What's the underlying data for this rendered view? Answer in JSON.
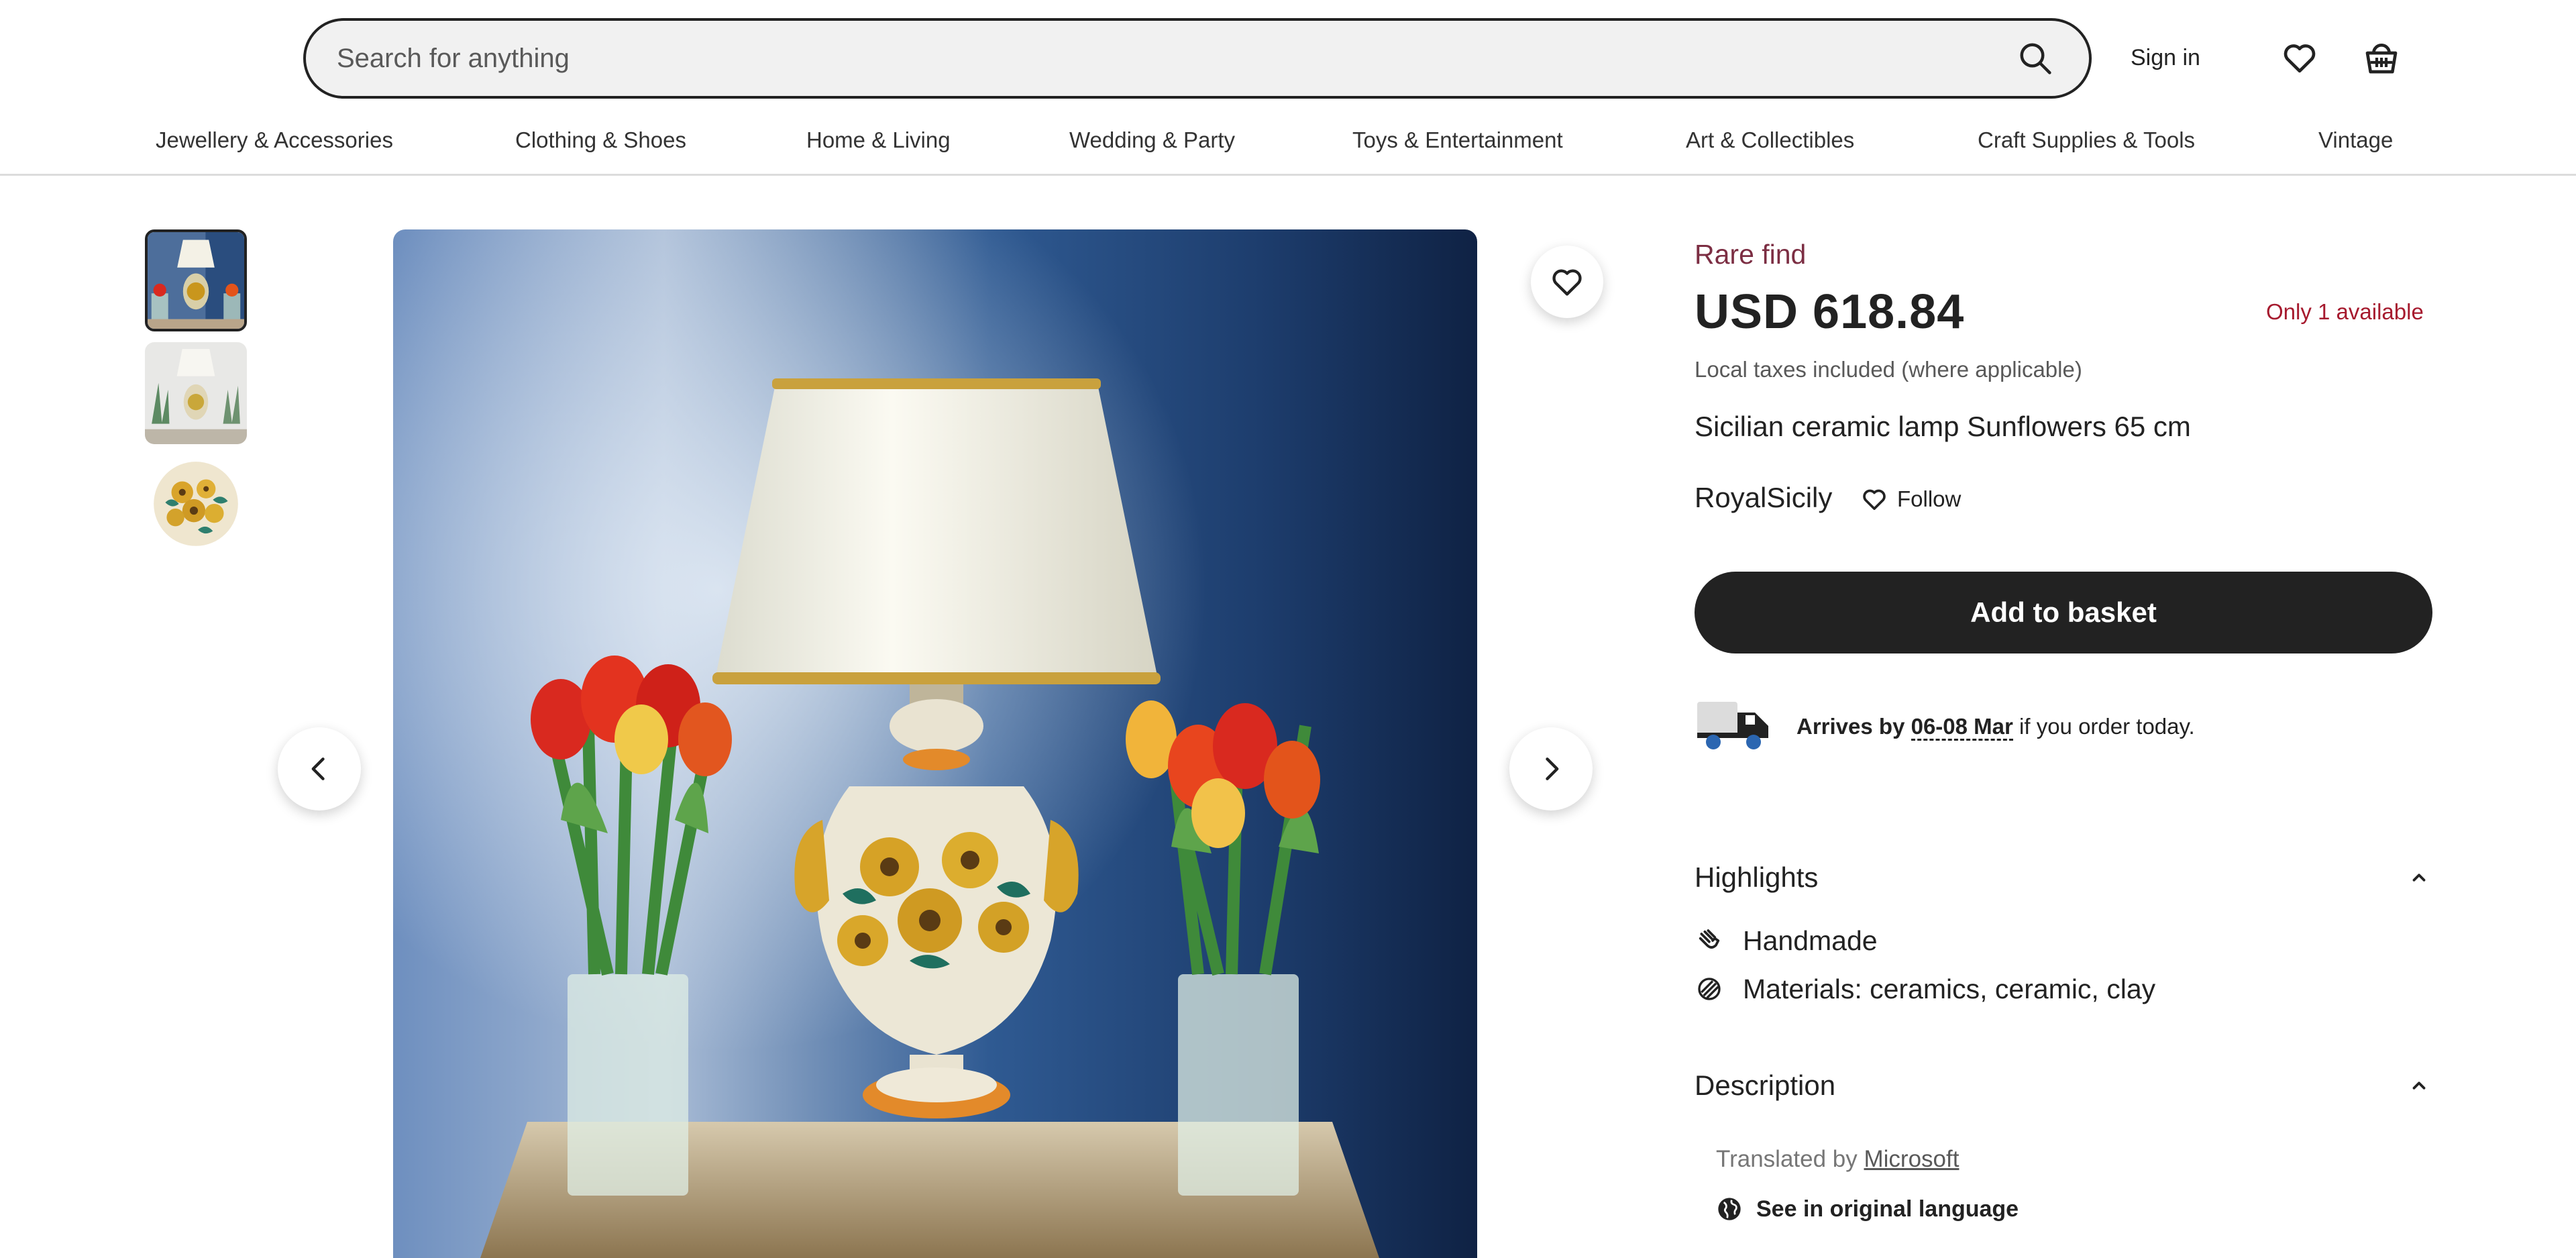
{
  "header": {
    "search_placeholder": "Search for anything",
    "sign_in": "Sign in",
    "icons": [
      "search-icon",
      "heart-icon",
      "basket-icon"
    ]
  },
  "categories": [
    "Jewellery & Accessories",
    "Clothing & Shoes",
    "Home & Living",
    "Wedding & Party",
    "Toys & Entertainment",
    "Art & Collectibles",
    "Craft Supplies & Tools",
    "Vintage"
  ],
  "listing": {
    "rare_find": "Rare find",
    "price": "USD 618.84",
    "availability": "Only 1 available",
    "tax_note": "Local taxes included (where applicable)",
    "title": "Sicilian ceramic lamp Sunflowers 65 cm",
    "shop_name": "RoyalSicily",
    "follow_label": "Follow",
    "add_to_basket": "Add to basket",
    "delivery": {
      "prefix": "Arrives by ",
      "date": "06-08 Mar",
      "suffix": " if you order today."
    },
    "highlights": {
      "title": "Highlights",
      "items": [
        "Handmade",
        "Materials: ceramics, ceramic, clay"
      ]
    },
    "description": {
      "title": "Description",
      "translated_prefix": "Translated by ",
      "translated_by": "Microsoft",
      "see_original": "See in original language"
    }
  },
  "gallery": {
    "thumbnail_count": 3,
    "active_index": 0
  },
  "colors": {
    "accent_dark": "#222222",
    "rare_find": "#7c2e43",
    "availability": "#a61a2e",
    "search_bg": "#f1f1f1"
  }
}
